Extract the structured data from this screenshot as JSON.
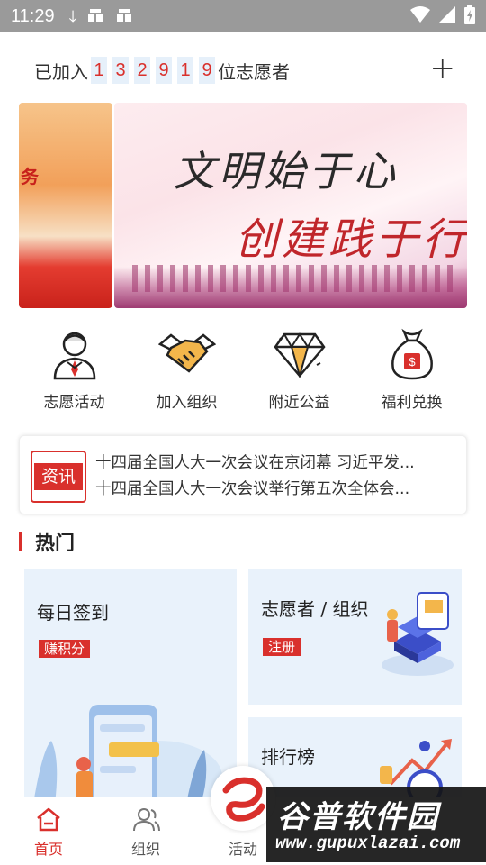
{
  "status_bar": {
    "time": "11:29",
    "icons": [
      "download-icon",
      "bug-icon",
      "bug-icon",
      "wifi-icon",
      "signal-icon",
      "battery-icon"
    ]
  },
  "join": {
    "prefix": "已加入",
    "digits": [
      "1",
      "3",
      "2",
      "9",
      "1",
      "9"
    ],
    "suffix": "位志愿者"
  },
  "banner": {
    "prev_text": "务",
    "line1": "文明始于心",
    "line2": "创建践于行"
  },
  "quick_actions": [
    {
      "label": "志愿活动",
      "icon": "volunteer-person-icon"
    },
    {
      "label": "加入组织",
      "icon": "handshake-icon"
    },
    {
      "label": "附近公益",
      "icon": "diamond-icon"
    },
    {
      "label": "福利兑换",
      "icon": "money-bag-icon"
    }
  ],
  "news": {
    "badge": "资讯",
    "items": [
      "十四届全国人大一次会议在京闭幕 习近平发...",
      "十四届全国人大一次会议举行第五次全体会..."
    ]
  },
  "section": {
    "title": "热门"
  },
  "cards": [
    {
      "title": "每日签到",
      "tag": "赚积分"
    },
    {
      "title": "志愿者 / 组织",
      "tag": "注册"
    },
    {
      "title": "排行榜",
      "tag": ""
    }
  ],
  "tabs": [
    {
      "label": "首页",
      "icon": "home-icon",
      "active": true
    },
    {
      "label": "组织",
      "icon": "people-icon",
      "active": false
    },
    {
      "label": "活动",
      "icon": "activity-icon",
      "active": false
    }
  ],
  "watermark": {
    "title": "谷普软件园",
    "url": "www.gupuxlazai.com"
  },
  "colors": {
    "accent": "#d9302c",
    "card_bg": "#e9f2fb"
  }
}
